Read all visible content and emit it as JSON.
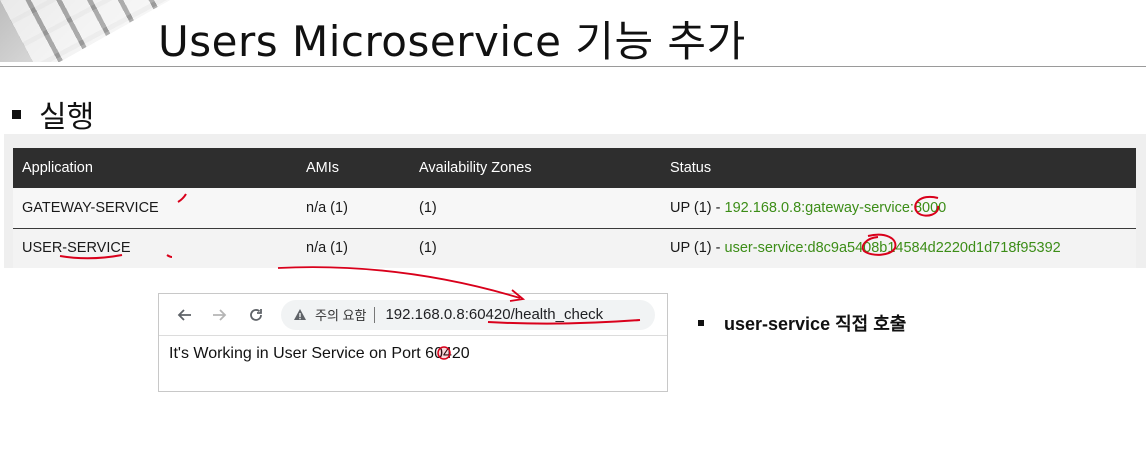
{
  "slide": {
    "title": "Users Microservice 기능 추가",
    "bullet_main": "실행",
    "bullet_side": "user-service 직접 호출"
  },
  "table": {
    "headers": [
      "Application",
      "AMIs",
      "Availability Zones",
      "Status"
    ],
    "rows": [
      {
        "application": "GATEWAY-SERVICE",
        "amis": "n/a (1)",
        "zones": "(1)",
        "status_prefix": "UP (1) - ",
        "status_link": "192.168.0.8:gateway-service:8000"
      },
      {
        "application": "USER-SERVICE",
        "amis": "n/a (1)",
        "zones": "(1)",
        "status_prefix": "UP (1) - ",
        "status_link": "user-service:d8c9a5408b14584d2220d1d718f95392"
      }
    ]
  },
  "browser": {
    "back_icon": "back-arrow-icon",
    "forward_icon": "forward-arrow-icon",
    "reload_icon": "reload-icon",
    "warning_icon": "warning-triangle-icon",
    "security_label": "주의 요함",
    "url_host": "192.168.0.8:",
    "url_port": "60420",
    "url_path": "/health_check",
    "page_text": "It's Working in User Service on Port 60420"
  },
  "colors": {
    "header_bg": "#2e2e2e",
    "link_green": "#3c8d17",
    "annotation_red": "#d9001b"
  }
}
